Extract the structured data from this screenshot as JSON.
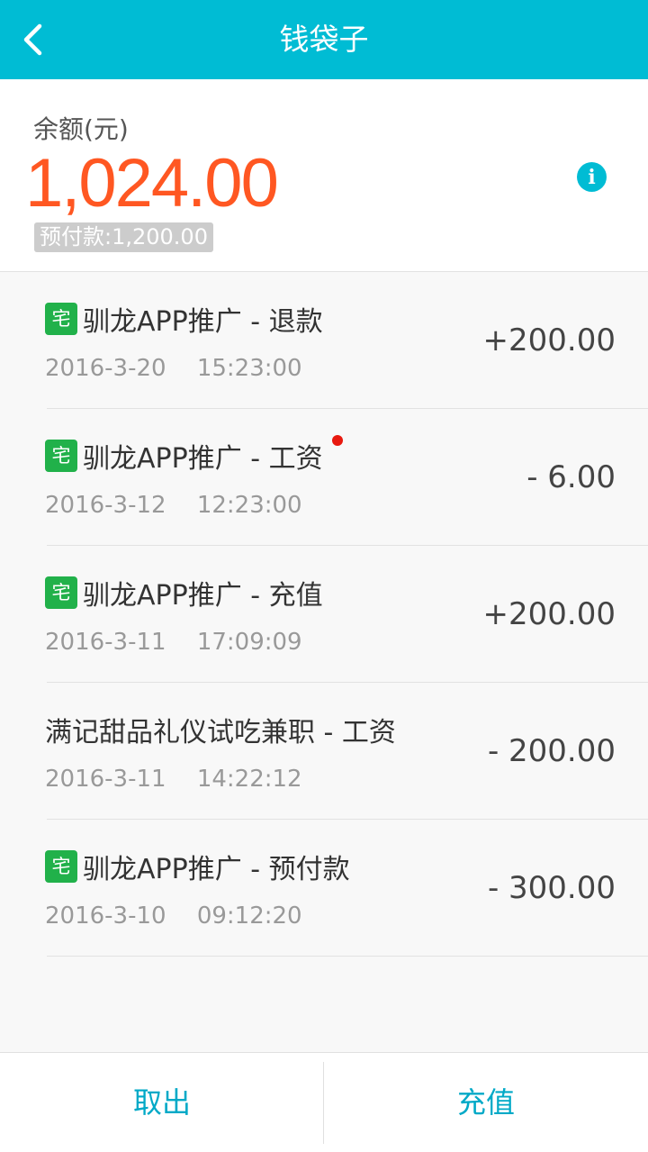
{
  "header": {
    "title": "钱袋子"
  },
  "balance": {
    "label": "余额(元)",
    "amount": "1,024.00",
    "prepaid": "预付款:1,200.00"
  },
  "transactions": [
    {
      "tag": "宅",
      "title": "驯龙APP推广 - 退款",
      "date": "2016-3-20 15:23:00",
      "amount": "+200.00",
      "unread": false
    },
    {
      "tag": "宅",
      "title": "驯龙APP推广 - 工资",
      "date": "2016-3-12 12:23:00",
      "amount": "- 6.00",
      "unread": true
    },
    {
      "tag": "宅",
      "title": "驯龙APP推广 - 充值",
      "date": "2016-3-11 17:09:09",
      "amount": "+200.00",
      "unread": false
    },
    {
      "tag": "",
      "title": "满记甜品礼仪试吃兼职 - 工资",
      "date": "2016-3-11 14:22:12",
      "amount": "- 200.00",
      "unread": false
    },
    {
      "tag": "宅",
      "title": "驯龙APP推广 - 预付款",
      "date": "2016-3-10 09:12:20",
      "amount": "- 300.00",
      "unread": false
    }
  ],
  "footer": {
    "withdraw_label": "取出",
    "recharge_label": "充值"
  },
  "colors": {
    "accent": "#00bcd4",
    "balance": "#ff5722",
    "tag": "#21b14a",
    "unread_dot": "#e8190f"
  }
}
